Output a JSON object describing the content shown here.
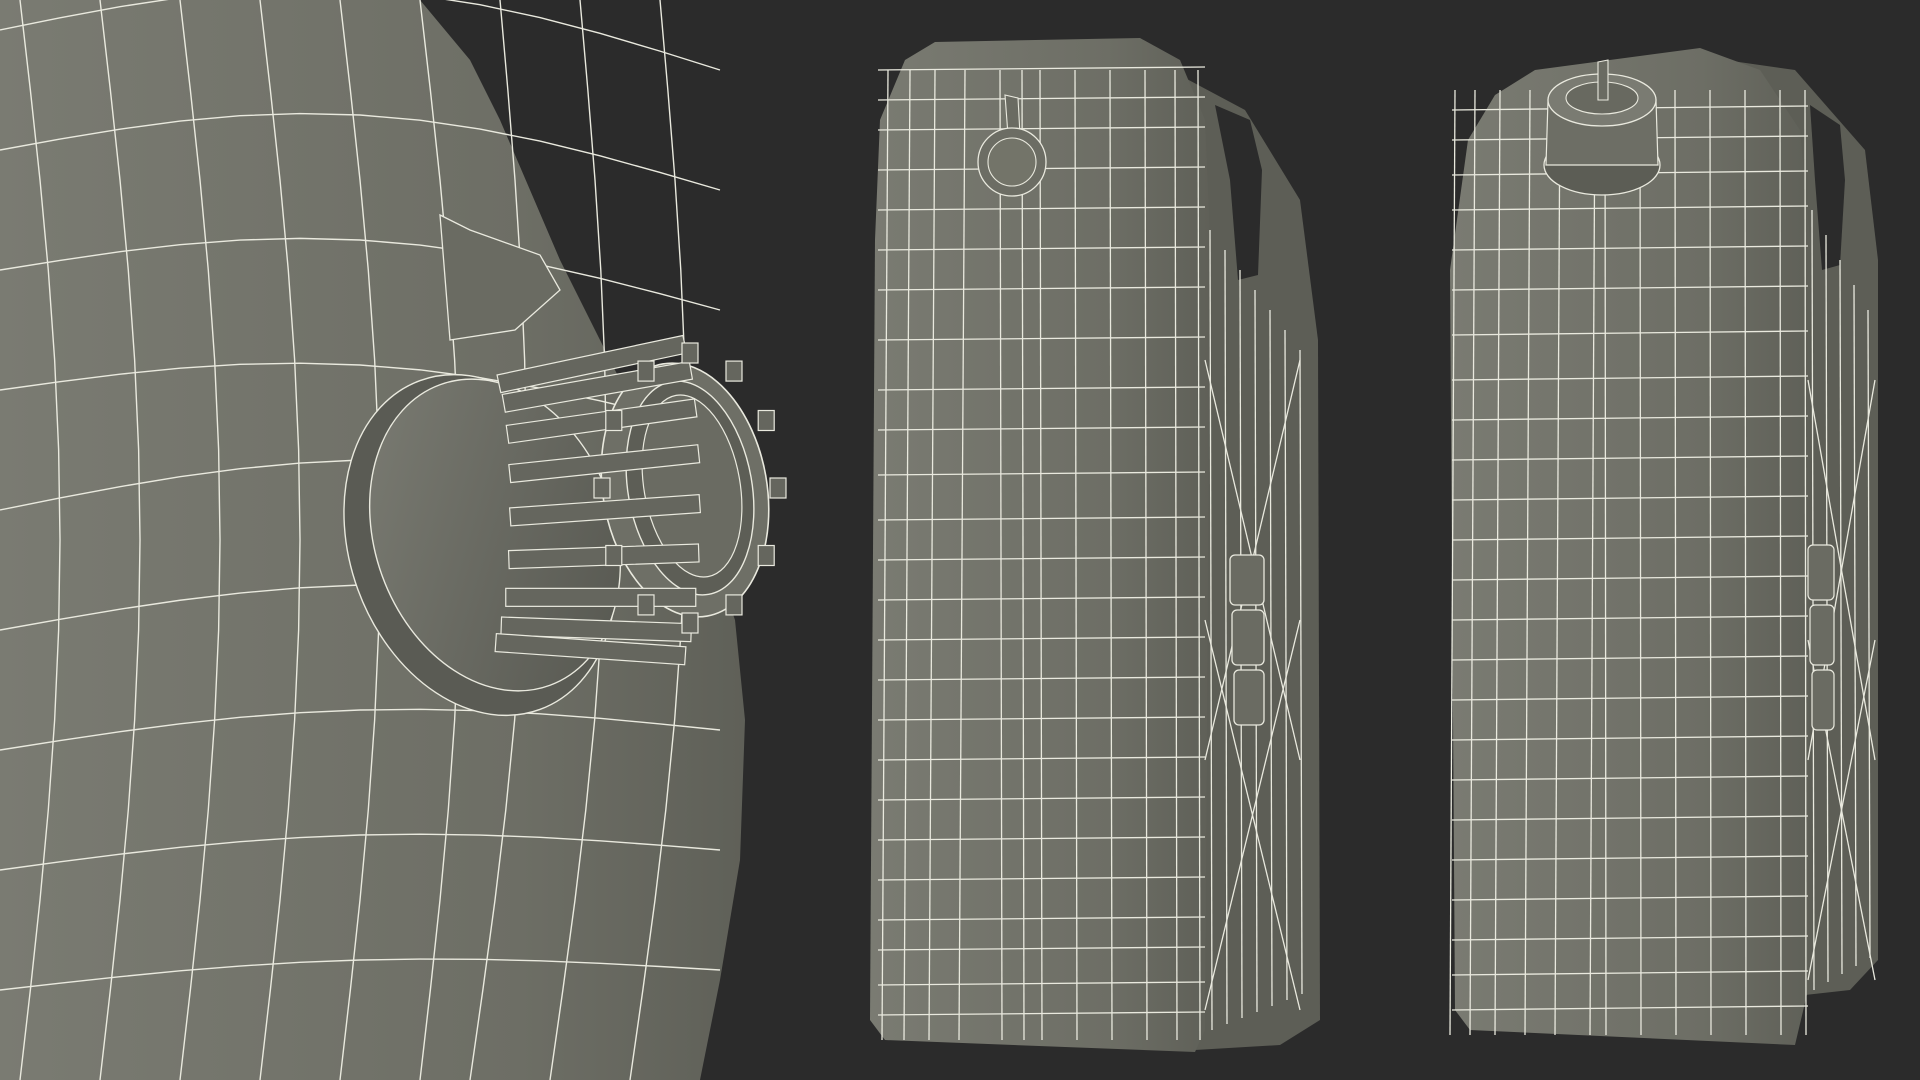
{
  "scene": {
    "background_color": "#2b2b2b",
    "mesh_fill_color": "#6f7067",
    "mesh_shade_color": "#5e5f57",
    "wire_color": "#e9e9de",
    "panels": [
      {
        "name": "closeup-cap-view",
        "icon": "cap-closeup-render"
      },
      {
        "name": "front-view-cap-closed",
        "icon": "jerrycan-front-render"
      },
      {
        "name": "front-view-cap-top",
        "icon": "jerrycan-angled-render"
      }
    ]
  }
}
